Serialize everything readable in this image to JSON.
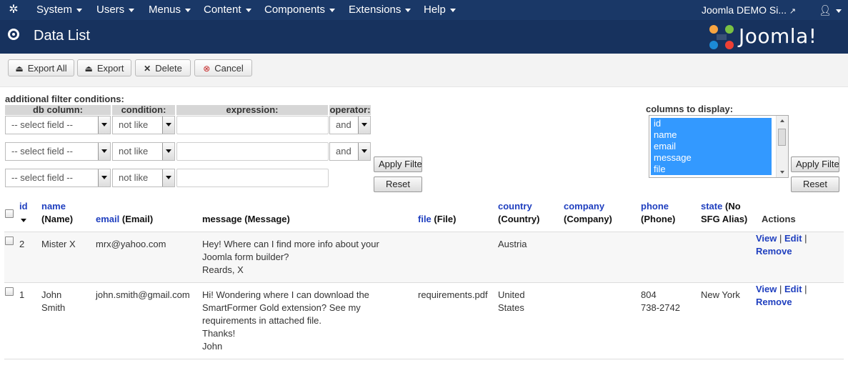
{
  "topnav": {
    "menus": [
      "System",
      "Users",
      "Menus",
      "Content",
      "Components",
      "Extensions",
      "Help"
    ],
    "site_link": "Joomla DEMO Si...",
    "user_icon": "user-icon"
  },
  "header": {
    "title": "Data List",
    "logo_text": "Joomla!"
  },
  "toolbar": {
    "export_all": "Export All",
    "export": "Export",
    "delete": "Delete",
    "cancel": "Cancel"
  },
  "filter": {
    "title": "additional filter conditions:",
    "col_db": "db column:",
    "col_condition": "condition:",
    "col_expression": "expression:",
    "col_operator": "operator:",
    "rows": [
      {
        "field": "-- select field --",
        "condition": "not like",
        "expression": "",
        "operator": "and"
      },
      {
        "field": "-- select field --",
        "condition": "not like",
        "expression": "",
        "operator": "and"
      },
      {
        "field": "-- select field --",
        "condition": "not like",
        "expression": ""
      }
    ],
    "apply": "Apply Filter",
    "reset": "Reset"
  },
  "columns": {
    "title": "columns to display:",
    "options": [
      "id",
      "name",
      "email",
      "message",
      "file"
    ],
    "apply": "Apply Filter",
    "reset": "Reset"
  },
  "table": {
    "headers": {
      "id": "id",
      "name_link": "name",
      "name_sub": "(Name)",
      "email_link": "email",
      "email_sub": "(Email)",
      "message": "message (Message)",
      "file_link": "file",
      "file_sub": "(File)",
      "country_link": "country",
      "country_sub": "(Country)",
      "company_link": "company",
      "company_sub": "(Company)",
      "phone_link": "phone",
      "phone_sub": "(Phone)",
      "state_link": "state",
      "state_sub1": "(No",
      "state_sub2": "SFG Alias)",
      "actions": "Actions"
    },
    "rows": [
      {
        "id": "2",
        "name": [
          "Mister X"
        ],
        "email": "mrx@yahoo.com",
        "message": [
          "Hey! Where can I find more info about your",
          "Joomla form builder?",
          "Reards, X"
        ],
        "file": "",
        "country": [
          "Austria"
        ],
        "company": "",
        "phone": [],
        "state": "",
        "actions": {
          "view": "View",
          "edit": "Edit",
          "remove": "Remove"
        }
      },
      {
        "id": "1",
        "name": [
          "John",
          "Smith"
        ],
        "email": "john.smith@gmail.com",
        "message": [
          "Hi! Wondering where I can download the",
          "SmartFormer Gold extension? See my",
          "requirements in attached file.",
          "Thanks!",
          "John"
        ],
        "file": "requirements.pdf",
        "country": [
          "United",
          "States"
        ],
        "company": "",
        "phone": [
          "804",
          "738-2742"
        ],
        "state": "New York",
        "actions": {
          "view": "View",
          "edit": "Edit",
          "remove": "Remove"
        }
      }
    ]
  },
  "colors": {
    "topnav": "#1a3867",
    "header": "#17325e",
    "link": "#1f3fbf",
    "selection": "#3399ff"
  }
}
